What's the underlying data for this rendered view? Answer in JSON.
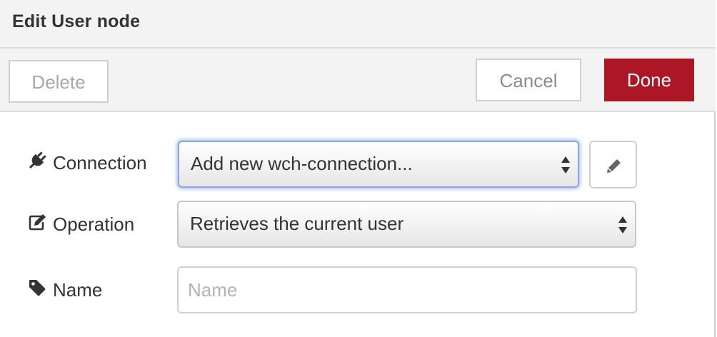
{
  "dialog": {
    "title": "Edit User node"
  },
  "toolbar": {
    "delete_label": "Delete",
    "cancel_label": "Cancel",
    "done_label": "Done"
  },
  "form": {
    "connection": {
      "label": "Connection",
      "icon": "plug-icon",
      "selected": "Add new wch-connection...",
      "edit_icon": "pencil-icon"
    },
    "operation": {
      "label": "Operation",
      "icon": "edit-icon",
      "selected": "Retrieves the current user"
    },
    "name": {
      "label": "Name",
      "icon": "tag-icon",
      "value": "",
      "placeholder": "Name"
    }
  },
  "colors": {
    "done_button": "#ad1625",
    "header_bg": "#f3f3f3",
    "focus_ring": "#8ea6e0"
  }
}
